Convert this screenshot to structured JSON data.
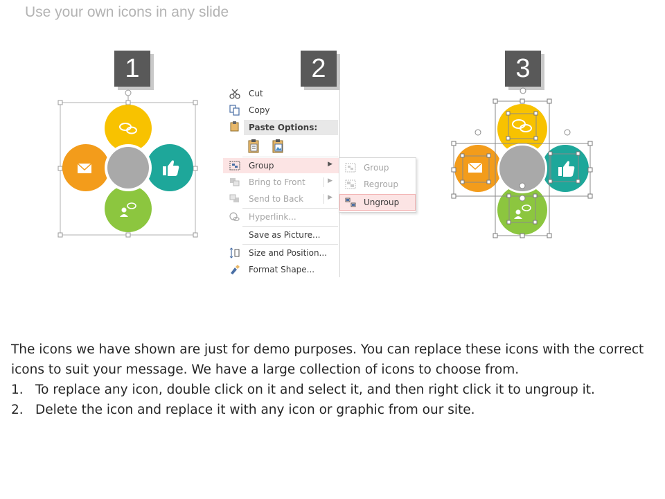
{
  "slide": {
    "title": "Use your own icons in any slide",
    "steps": [
      "1",
      "2",
      "3"
    ]
  },
  "colors": {
    "yellow": "#F8C200",
    "teal": "#1EA79A",
    "green": "#8CC63F",
    "orange": "#F39C1B",
    "gray": "#A9A9A9",
    "menu_highlight": "#FCE4E4"
  },
  "context_menu": {
    "cut": "Cut",
    "copy": "Copy",
    "paste_options": "Paste Options:",
    "group": "Group",
    "bring_to_front": "Bring to Front",
    "send_to_back": "Send to Back",
    "hyperlink": "Hyperlink...",
    "save_as_picture": "Save as Picture...",
    "size_and_position": "Size and Position...",
    "format_shape": "Format Shape..."
  },
  "submenu": {
    "group": "Group",
    "regroup": "Regroup",
    "ungroup": "Ungroup"
  },
  "icons": {
    "top": "speech-bubbles-icon",
    "right": "thumbs-up-icon",
    "bottom": "person-chat-icon",
    "left": "email-icon"
  },
  "instructions": {
    "intro": "The icons we have shown are just for demo purposes. You can replace these icons with the correct icons to suit your message. We have a large collection of icons to choose from.",
    "items": [
      {
        "num": "1.",
        "text": "To replace any icon, double click on it and select it, and then right click it to ungroup it."
      },
      {
        "num": "2.",
        "text": "Delete the icon and replace it with any icon or graphic from our site."
      }
    ]
  }
}
